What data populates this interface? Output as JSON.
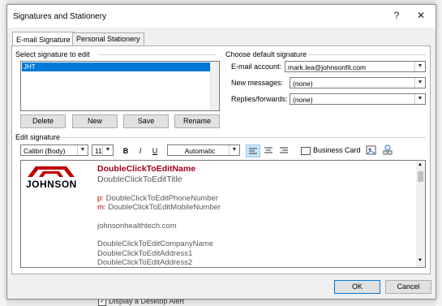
{
  "dialog": {
    "title": "Signatures and Stationery",
    "help": "?",
    "close": "✕"
  },
  "tabs": [
    {
      "label": "E-mail Signature"
    },
    {
      "label": "Personal Stationery"
    }
  ],
  "select_signature": {
    "heading": "Select signature to edit",
    "items": [
      "JHT"
    ]
  },
  "buttons": {
    "delete": "Delete",
    "new": "New",
    "save": "Save",
    "rename": "Rename"
  },
  "defaults": {
    "heading": "Choose default signature",
    "email_account_label": "E-mail account:",
    "email_account_value": "mark.lea@johnsonfit.com",
    "new_messages_label": "New messages:",
    "new_messages_value": "(none)",
    "replies_label": "Replies/forwards:",
    "replies_value": "(none)"
  },
  "edit": {
    "heading": "Edit signature",
    "font": "Calibri (Body)",
    "size": "11",
    "bold": "B",
    "italic": "I",
    "underline": "U",
    "color": "Automatic",
    "business_card": "Business Card"
  },
  "signature": {
    "logo_text": "JOHNSON",
    "name": "DoubleClickToEditName",
    "title": "DoubleClickToEditTitle",
    "phone_prefix": "p:",
    "phone": "DoubleClickToEditPhoneNumber",
    "mobile_prefix": "m:",
    "mobile": "DoubleClickToEditMobileNumber",
    "website": "johnsonhealthtech.com",
    "company": "DoubleClickToEditCompanyName",
    "address1": "DoubleClickToEditAddress1",
    "address2": "DoubleClickToEditAddress2"
  },
  "footer": {
    "ok": "OK",
    "cancel": "Cancel",
    "behind_text": "Display a Desktop Alert"
  },
  "colors": {
    "accent": "#0078d7",
    "brand_red": "#c00000",
    "name_red": "#a00018"
  }
}
